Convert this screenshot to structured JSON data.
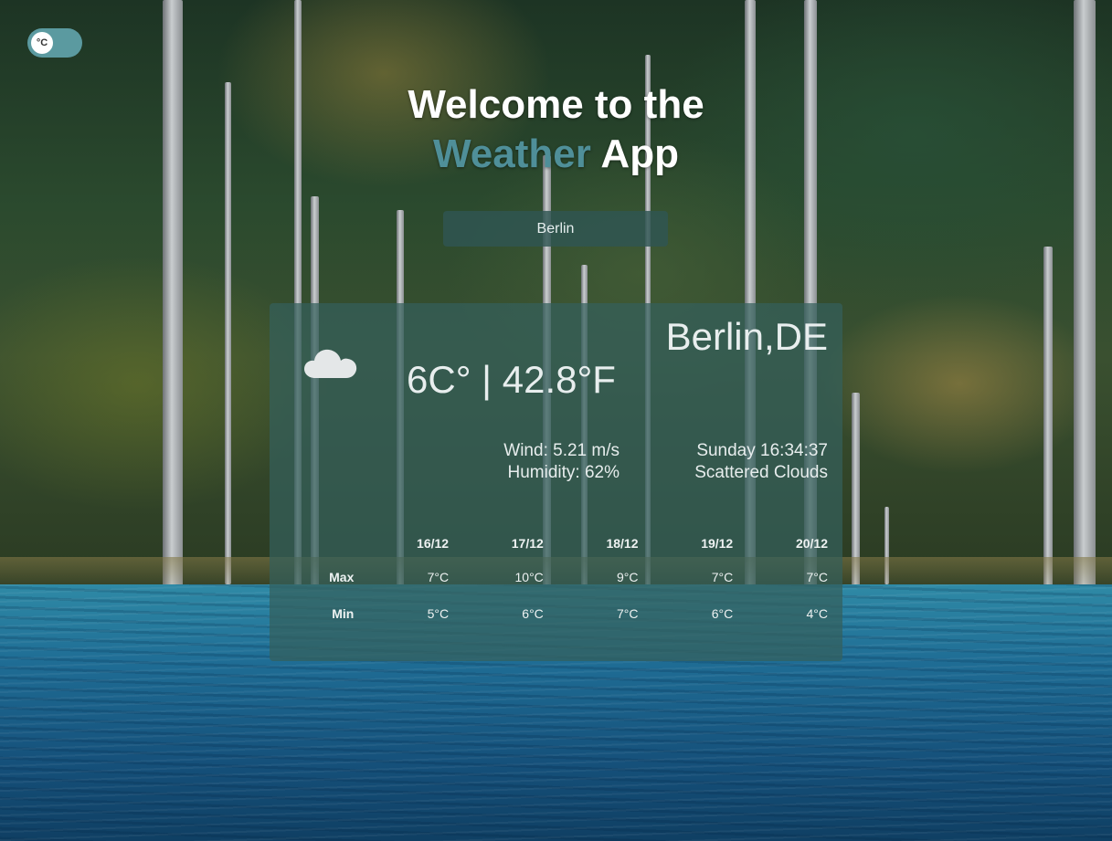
{
  "unit_toggle": {
    "label": "°C"
  },
  "header": {
    "line1": "Welcome to the",
    "accent": "Weather",
    "line2_rest": " App"
  },
  "search": {
    "value": "Berlin",
    "placeholder": ""
  },
  "current": {
    "icon": "cloud-icon",
    "city": "Berlin,DE",
    "temperature": "6C° | 42.8°F",
    "wind": "Wind: 5.21 m/s",
    "humidity": "Humidity: 62%",
    "datetime": "Sunday 16:34:37",
    "description": "Scattered Clouds"
  },
  "forecast": {
    "row_labels": {
      "max": "Max",
      "min": "Min"
    },
    "days": [
      {
        "date": "16/12",
        "max": "7°C",
        "min": "5°C"
      },
      {
        "date": "17/12",
        "max": "10°C",
        "min": "6°C"
      },
      {
        "date": "18/12",
        "max": "9°C",
        "min": "7°C"
      },
      {
        "date": "19/12",
        "max": "7°C",
        "min": "6°C"
      },
      {
        "date": "20/12",
        "max": "7°C",
        "min": "4°C"
      }
    ]
  },
  "colors": {
    "accent": "#4f8f99",
    "toggle": "#5b9aa0",
    "card": "#34605c"
  }
}
